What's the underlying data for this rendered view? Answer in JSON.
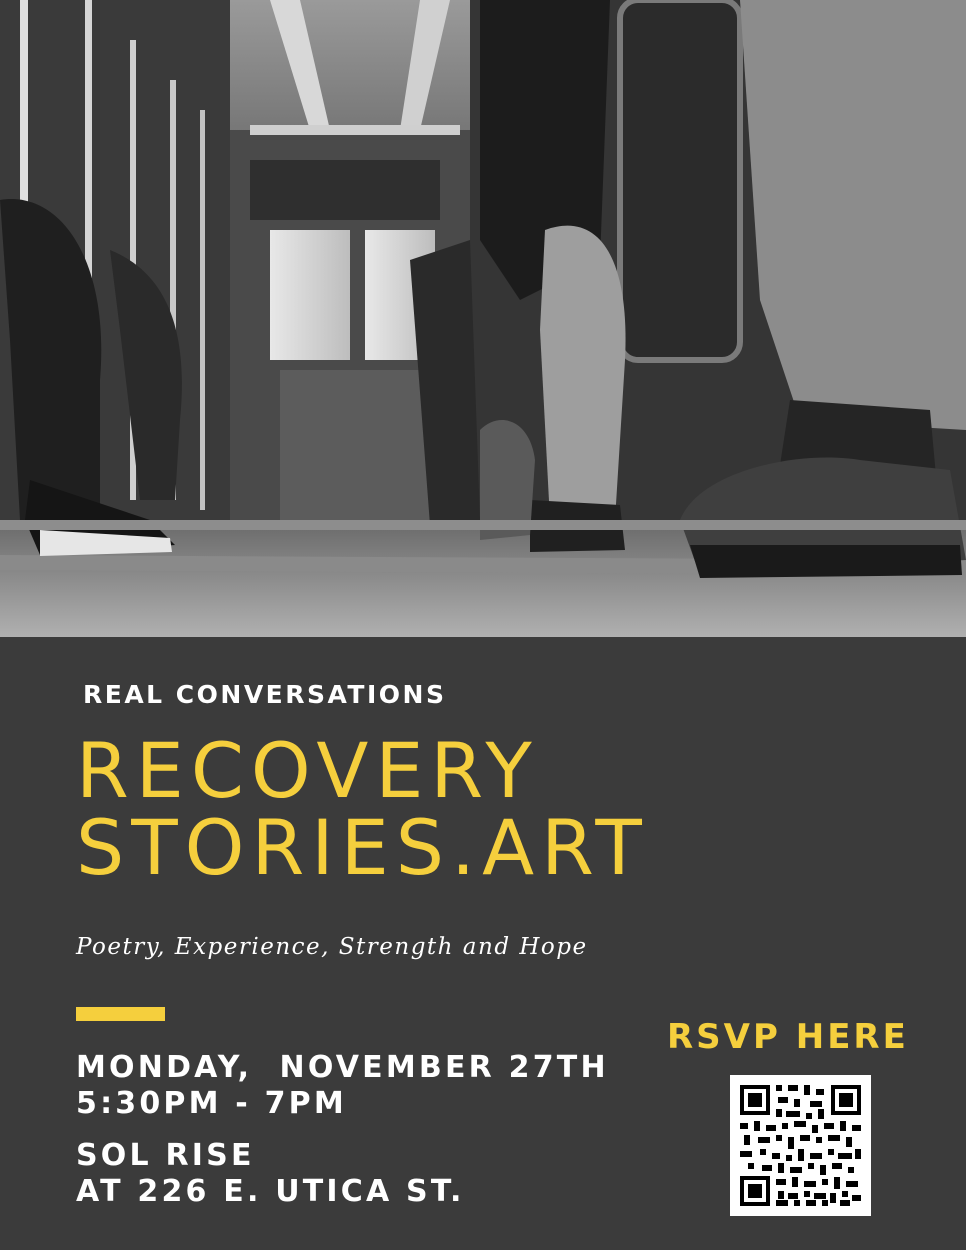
{
  "photo": {
    "subject": "black-and-white photo of passengers' legs and shoes inside a bus aisle"
  },
  "event": {
    "kicker": "REAL CONVERSATIONS",
    "title_line1": "RECOVERY",
    "title_line2": "STORIES.ART",
    "tagline": "Poetry, Experience, Strength and Hope",
    "date": "MONDAY,  NOVEMBER 27TH",
    "time": "5:30PM - 7PM",
    "venue": "SOL RISE",
    "address": "AT 226 E. UTICA ST."
  },
  "rsvp": {
    "label": "RSVP HERE",
    "qr_icon": "qr-code-icon"
  },
  "colors": {
    "background": "#3b3b3b",
    "accent": "#f5cf3d",
    "text": "#ffffff"
  }
}
